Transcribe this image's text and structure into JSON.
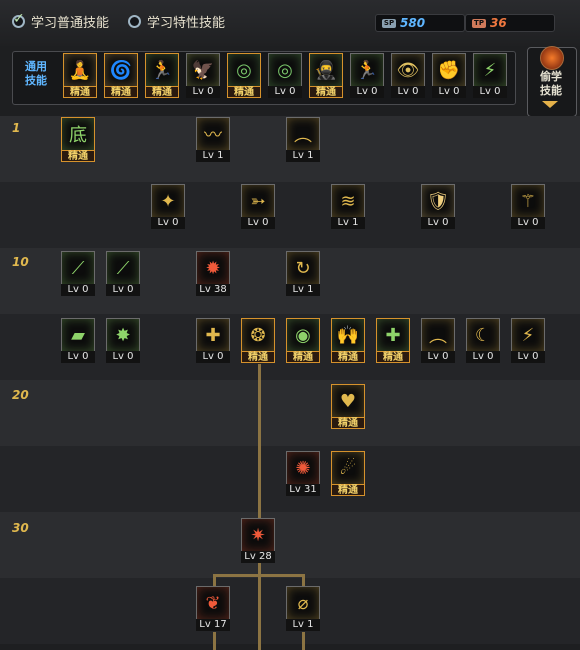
{
  "tabs": {
    "normal": "学习普通技能",
    "special": "学习特性技能"
  },
  "sp": {
    "sp_tag": "SP",
    "sp_value": "580",
    "tp_tag": "TP",
    "tp_value": "36"
  },
  "common": {
    "label_line1": "通用",
    "label_line2": "技能"
  },
  "steal": {
    "label_line1": "偷学",
    "label_line2": "技能"
  },
  "levels": {
    "l1": "1",
    "l10": "10",
    "l20": "20",
    "l30": "30"
  },
  "colors": {
    "accent": "#e0b84e",
    "master_border": "#d6922c",
    "link_blue": "#5fb6ff",
    "sp": "#5fb6ff",
    "tp": "#f07840"
  },
  "common_skills": [
    {
      "label": "精通",
      "icon": "🧘",
      "color": "#f0c070",
      "mastered": true
    },
    {
      "label": "精通",
      "icon": "🌀",
      "color": "#f0c070",
      "mastered": true
    },
    {
      "label": "精通",
      "icon": "🏃",
      "color": "#8ed36a",
      "mastered": true
    },
    {
      "label": "Lv 0",
      "icon": "🦅",
      "color": "#c8d870",
      "mastered": false
    },
    {
      "label": "精通",
      "icon": "◎",
      "color": "#79c56a",
      "mastered": true
    },
    {
      "label": "Lv 0",
      "icon": "◎",
      "color": "#79c56a",
      "mastered": false
    },
    {
      "label": "精通",
      "icon": "🥷",
      "color": "#8ed36a",
      "mastered": true
    },
    {
      "label": "Lv 0",
      "icon": "🏃",
      "color": "#8ed36a",
      "mastered": false
    },
    {
      "label": "Lv 0",
      "icon": "👁",
      "color": "#e0c060",
      "mastered": false
    },
    {
      "label": "Lv 0",
      "icon": "✊",
      "color": "#e0c060",
      "mastered": false
    },
    {
      "label": "Lv 0",
      "icon": "⚡",
      "color": "#8ed36a",
      "mastered": false
    }
  ],
  "tree_skills": [
    {
      "label": "精通",
      "icon": "底",
      "color": "#8ed36a",
      "mastered": true
    },
    {
      "label": "Lv 1",
      "icon": "〰",
      "color": "#e0b84e",
      "mastered": false
    },
    {
      "label": "Lv 1",
      "icon": "︵",
      "color": "#e0b84e",
      "mastered": false
    },
    {
      "label": "Lv 0",
      "icon": "✦",
      "color": "#e0b84e",
      "mastered": false
    },
    {
      "label": "Lv 0",
      "icon": "➳",
      "color": "#e0b84e",
      "mastered": false
    },
    {
      "label": "Lv 1",
      "icon": "≋",
      "color": "#e0b84e",
      "mastered": false
    },
    {
      "label": "Lv 0",
      "icon": "🛡",
      "color": "#f0d080",
      "mastered": false
    },
    {
      "label": "Lv 0",
      "icon": "⚚",
      "color": "#e0b84e",
      "mastered": false
    },
    {
      "label": "Lv 0",
      "icon": "⟋",
      "color": "#8ed36a",
      "mastered": false
    },
    {
      "label": "Lv 0",
      "icon": "⟋",
      "color": "#8ed36a",
      "mastered": false
    },
    {
      "label": "Lv 38",
      "icon": "✹",
      "color": "#f05a3a",
      "mastered": false
    },
    {
      "label": "Lv 1",
      "icon": "↻",
      "color": "#e0b84e",
      "mastered": false
    },
    {
      "label": "Lv 0",
      "icon": "▰",
      "color": "#8ed36a",
      "mastered": false
    },
    {
      "label": "Lv 0",
      "icon": "✸",
      "color": "#8ed36a",
      "mastered": false
    },
    {
      "label": "Lv 0",
      "icon": "✚",
      "color": "#e0b84e",
      "mastered": false
    },
    {
      "label": "精通",
      "icon": "❂",
      "color": "#e0b84e",
      "mastered": true
    },
    {
      "label": "精通",
      "icon": "◉",
      "color": "#8ed36a",
      "mastered": true
    },
    {
      "label": "精通",
      "icon": "🙌",
      "color": "#8ed36a",
      "mastered": true
    },
    {
      "label": "精通",
      "icon": "✚",
      "color": "#8ed36a",
      "mastered": true
    },
    {
      "label": "Lv 0",
      "icon": "︵",
      "color": "#e0b84e",
      "mastered": false
    },
    {
      "label": "Lv 0",
      "icon": "☾",
      "color": "#e0b84e",
      "mastered": false
    },
    {
      "label": "Lv 0",
      "icon": "⚡",
      "color": "#e0b84e",
      "mastered": false
    },
    {
      "label": "精通",
      "icon": "♥",
      "color": "#e0b84e",
      "mastered": true
    },
    {
      "label": "Lv 31",
      "icon": "✺",
      "color": "#f05a3a",
      "mastered": false
    },
    {
      "label": "精通",
      "icon": "☄",
      "color": "#e0b84e",
      "mastered": true
    },
    {
      "label": "Lv 28",
      "icon": "✷",
      "color": "#f05a3a",
      "mastered": false
    },
    {
      "label": "Lv 17",
      "icon": "❦",
      "color": "#f05a3a",
      "mastered": false
    },
    {
      "label": "Lv 1",
      "icon": "⌀",
      "color": "#e0b84e",
      "mastered": false
    }
  ]
}
